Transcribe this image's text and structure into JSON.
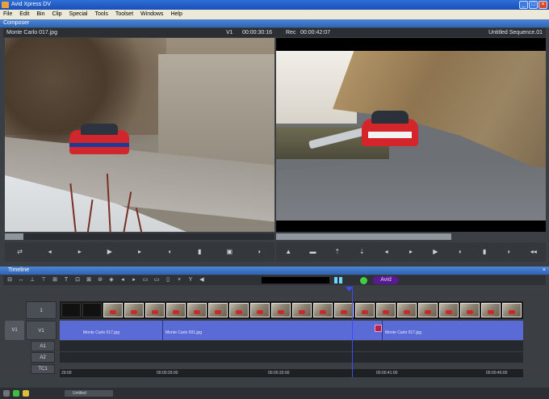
{
  "window": {
    "title": "Avid Xpress DV"
  },
  "menu": [
    "File",
    "Edit",
    "Bin",
    "Clip",
    "Special",
    "Tools",
    "Toolset",
    "Windows",
    "Help"
  ],
  "composer": {
    "title": "Composer",
    "source_clip": "Monte Carlo 017.jpg",
    "tc_label_1": "V1",
    "tc_value_1": "00:00:30:16",
    "tc_label_2": "Rec",
    "tc_value_2": "00:00:42:07",
    "sequence": "Untitled Sequence.01",
    "source_progress": 0.07,
    "record_progress": 0.65
  },
  "timeline": {
    "title": "Timeline",
    "timecode": "",
    "avid_label": "Avid",
    "tracks": {
      "v2": "1",
      "v1_src": "V1",
      "v1": "V1",
      "a1": "A1",
      "a2": "A2",
      "tc": "TC1"
    },
    "clips": [
      {
        "label": "Monte Carlo 017.jpg"
      },
      {
        "label": "Monte Carlo 091.jpg"
      },
      {
        "label": "Monte Carlo 017.jpg"
      }
    ],
    "ruler": [
      "29:00",
      "00:00:29:00",
      "00:00:33:00",
      "00:00:41:00",
      "00:00:49:00"
    ]
  },
  "status": {
    "label": "Untitled"
  },
  "icons": {
    "close": "close-icon",
    "minimize": "minimize-icon",
    "maximize": "maximize-icon"
  },
  "colors": {
    "title_blue": "#2d6fd8",
    "clip_blue": "#5a6bd6",
    "playhead": "#3b4cff",
    "avid_purple": "#5a1a8f"
  }
}
